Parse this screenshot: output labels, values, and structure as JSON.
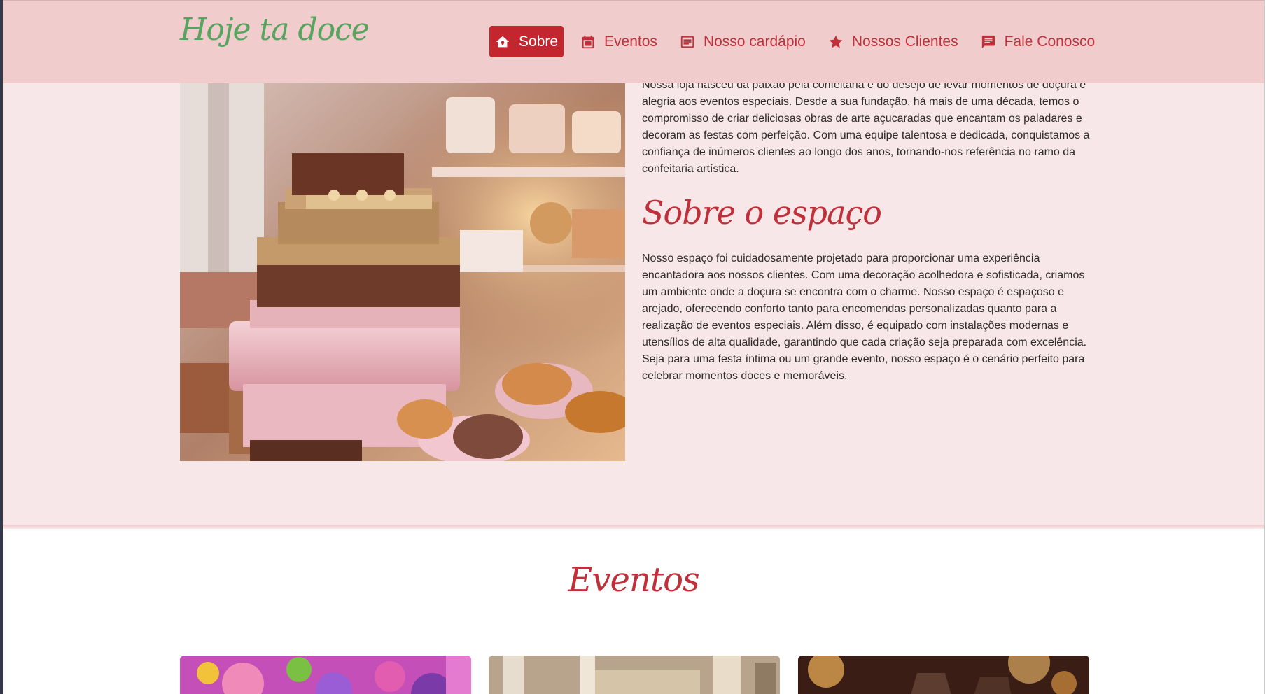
{
  "brand": {
    "logo_text": "Hoje ta doce"
  },
  "nav": {
    "items": [
      {
        "label": "Sobre",
        "icon": "home-icon",
        "active": true
      },
      {
        "label": "Eventos",
        "icon": "calendar-icon",
        "active": false
      },
      {
        "label": "Nosso cardápio",
        "icon": "menu-card-icon",
        "active": false
      },
      {
        "label": "Nossos Clientes",
        "icon": "star-icon",
        "active": false
      },
      {
        "label": "Fale Conosco",
        "icon": "chat-icon",
        "active": false
      }
    ]
  },
  "about": {
    "image_alt": "bakery-display-image",
    "intro_paragraph": "Nossa loja nasceu da paixão pela confeitaria e do desejo de levar momentos de doçura e alegria aos eventos especiais. Desde a sua fundação, há mais de uma década, temos o compromisso de criar deliciosas obras de arte açucaradas que encantam os paladares e decoram as festas com perfeição. Com uma equipe talentosa e dedicada, conquistamos a confiança de inúmeros clientes ao longo dos anos, tornando-nos referência no ramo da confeitaria artística.",
    "space_heading": "Sobre o espaço",
    "space_paragraph": "Nosso espaço foi cuidadosamente projetado para proporcionar uma experiência encantadora aos nossos clientes. Com uma decoração acolhedora e sofisticada, criamos um ambiente onde a doçura se encontra com o charme. Nosso espaço é espaçoso e arejado, oferecendo conforto tanto para encomendas personalizadas quanto para a realização de eventos especiais. Além disso, é equipado com instalações modernas e utensílios de alta qualidade, garantindo que cada criação seja preparada com excelência. Seja para uma festa íntima ou um grande evento, nosso espaço é o cenário perfeito para celebrar momentos doces e memoráveis."
  },
  "events": {
    "heading": "Eventos"
  },
  "colors": {
    "header_bg": "#f0cccd",
    "page_bg": "#f8e7e8",
    "accent": "#c4262f",
    "logo": "#56a45d"
  }
}
